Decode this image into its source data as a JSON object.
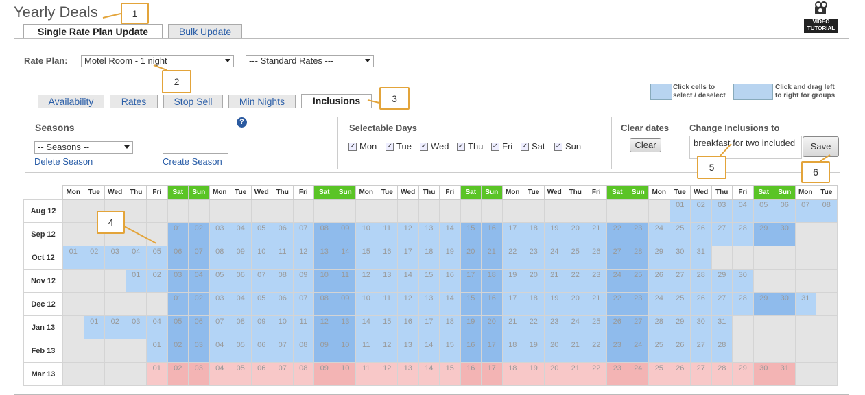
{
  "page_title": "Yearly Deals",
  "video_tutorial_label": "VIDEO TUTORIAL",
  "main_tabs": [
    {
      "label": "Single Rate Plan Update",
      "active": true
    },
    {
      "label": "Bulk Update",
      "active": false
    }
  ],
  "rate_plan": {
    "label": "Rate Plan:",
    "plan_value": "Motel Room - 1 night",
    "rates_value": "--- Standard Rates ---"
  },
  "sub_tabs": [
    {
      "label": "Availability"
    },
    {
      "label": "Rates"
    },
    {
      "label": "Stop Sell"
    },
    {
      "label": "Min Nights"
    },
    {
      "label": "Inclusions"
    }
  ],
  "hints": {
    "click_cells": "Click cells to select / deselect",
    "drag": "Click and drag left to right for groups"
  },
  "seasons": {
    "heading": "Seasons",
    "select_value": "-- Seasons --",
    "delete_link": "Delete Season",
    "create_link": "Create Season",
    "new_name_value": ""
  },
  "selectable_days": {
    "heading": "Selectable Days",
    "days": [
      "Mon",
      "Tue",
      "Wed",
      "Thu",
      "Fri",
      "Sat",
      "Sun"
    ]
  },
  "clear_dates": {
    "heading": "Clear dates",
    "button": "Clear"
  },
  "inclusions": {
    "heading": "Change Inclusions to",
    "value": "breakfast for two included",
    "save_button": "Save"
  },
  "callouts": [
    "1",
    "2",
    "3",
    "4",
    "5",
    "6"
  ],
  "calendar": {
    "day_headers": [
      "Mon",
      "Tue",
      "Wed",
      "Thu",
      "Fri",
      "Sat",
      "Sun",
      "Mon",
      "Tue",
      "Wed",
      "Thu",
      "Fri",
      "Sat",
      "Sun",
      "Mon",
      "Tue",
      "Wed",
      "Thu",
      "Fri",
      "Sat",
      "Sun",
      "Mon",
      "Tue",
      "Wed",
      "Thu",
      "Fri",
      "Sat",
      "Sun",
      "Mon",
      "Tue",
      "Wed",
      "Thu",
      "Fri",
      "Sat",
      "Sun",
      "Mon",
      "Tue"
    ],
    "weekend_color": "#5ac426",
    "selected_color": "#b3d4f6",
    "months": [
      {
        "label": "Aug 12",
        "offset": 29,
        "days": 31,
        "shade": "none"
      },
      {
        "label": "Sep 12",
        "offset": 5,
        "days": 30,
        "shade": "blue"
      },
      {
        "label": "Oct 12",
        "offset": 0,
        "days": 31,
        "shade": "blue"
      },
      {
        "label": "Nov 12",
        "offset": 3,
        "days": 30,
        "shade": "blue"
      },
      {
        "label": "Dec 12",
        "offset": 5,
        "days": 31,
        "shade": "blue"
      },
      {
        "label": "Jan 13",
        "offset": 1,
        "days": 31,
        "shade": "blue"
      },
      {
        "label": "Feb 13",
        "offset": 4,
        "days": 28,
        "shade": "blue"
      },
      {
        "label": "Mar 13",
        "offset": 4,
        "days": 31,
        "shade": "pink"
      }
    ]
  }
}
